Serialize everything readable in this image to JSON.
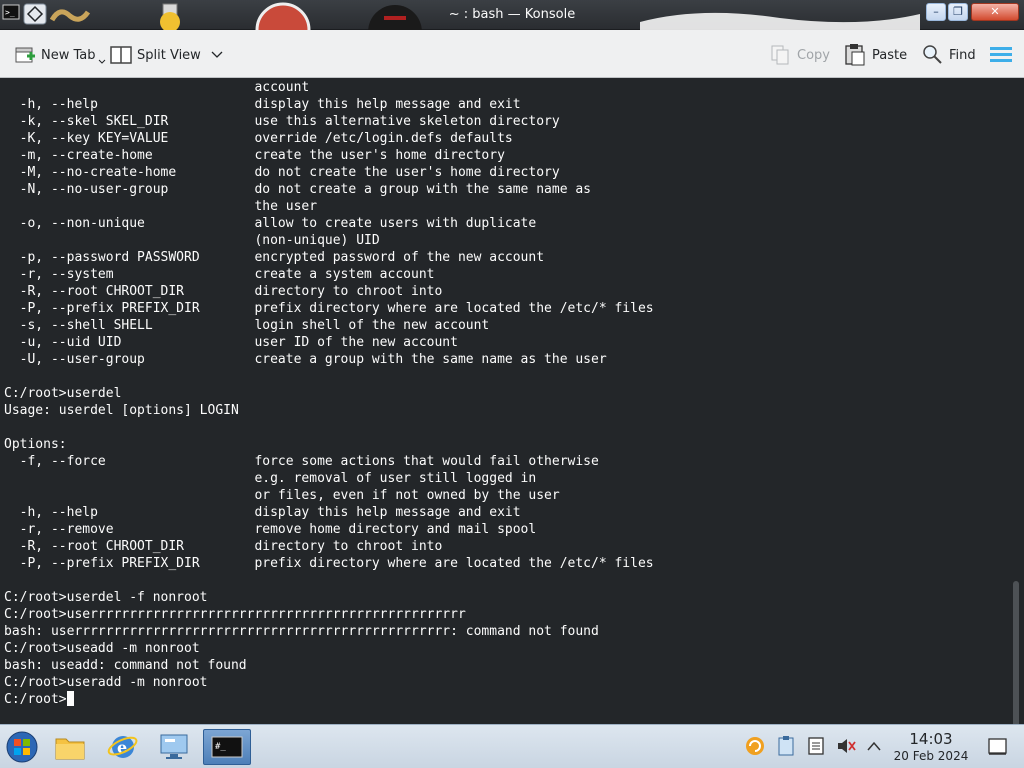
{
  "window": {
    "title": "~ : bash — Konsole",
    "controls": [
      "minimize",
      "maximize",
      "close"
    ]
  },
  "toolbar": {
    "new_tab": "New Tab",
    "split_view": "Split View",
    "copy": "Copy",
    "paste": "Paste",
    "find": "Find"
  },
  "terminal": {
    "lines": [
      "                                account",
      "  -h, --help                    display this help message and exit",
      "  -k, --skel SKEL_DIR           use this alternative skeleton directory",
      "  -K, --key KEY=VALUE           override /etc/login.defs defaults",
      "  -m, --create-home             create the user's home directory",
      "  -M, --no-create-home          do not create the user's home directory",
      "  -N, --no-user-group           do not create a group with the same name as",
      "                                the user",
      "  -o, --non-unique              allow to create users with duplicate",
      "                                (non-unique) UID",
      "  -p, --password PASSWORD       encrypted password of the new account",
      "  -r, --system                  create a system account",
      "  -R, --root CHROOT_DIR         directory to chroot into",
      "  -P, --prefix PREFIX_DIR       prefix directory where are located the /etc/* files",
      "  -s, --shell SHELL             login shell of the new account",
      "  -u, --uid UID                 user ID of the new account",
      "  -U, --user-group              create a group with the same name as the user",
      "",
      "C:/root>userdel",
      "Usage: userdel [options] LOGIN",
      "",
      "Options:",
      "  -f, --force                   force some actions that would fail otherwise",
      "                                e.g. removal of user still logged in",
      "                                or files, even if not owned by the user",
      "  -h, --help                    display this help message and exit",
      "  -r, --remove                  remove home directory and mail spool",
      "  -R, --root CHROOT_DIR         directory to chroot into",
      "  -P, --prefix PREFIX_DIR       prefix directory where are located the /etc/* files",
      "",
      "C:/root>userdel -f nonroot",
      "C:/root>userrrrrrrrrrrrrrrrrrrrrrrrrrrrrrrrrrrrrrrrrrrrrrrr",
      "bash: userrrrrrrrrrrrrrrrrrrrrrrrrrrrrrrrrrrrrrrrrrrrrrrr: command not found",
      "C:/root>useadd -m nonroot",
      "bash: useadd: command not found",
      "C:/root>useradd -m nonroot"
    ],
    "prompt": "C:/root>"
  },
  "taskbar": {
    "apps": [
      "start-orb",
      "file-manager",
      "web-browser",
      "system-monitor",
      "konsole"
    ],
    "clock_time": "14:03",
    "clock_date": "20 Feb 2024"
  },
  "colors": {
    "terminal_bg": "#232629",
    "terminal_fg": "#fcfcfc",
    "toolbar_bg": "#eff0f1",
    "accent": "#3daee9"
  }
}
